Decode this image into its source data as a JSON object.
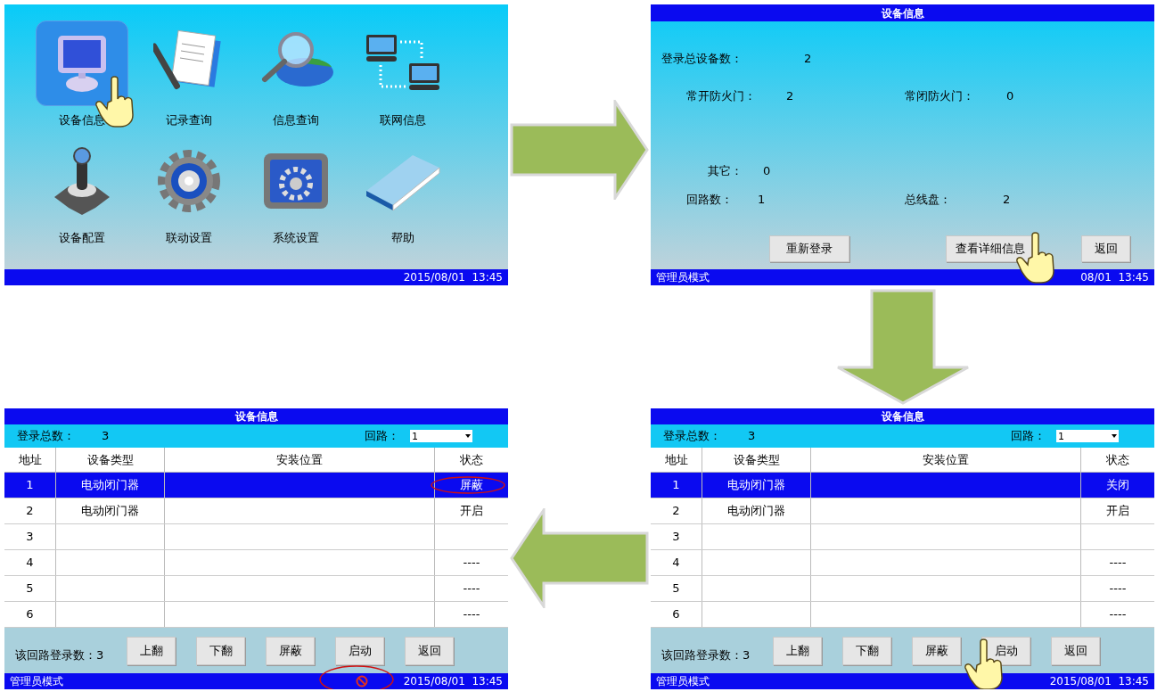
{
  "menu_screen": {
    "menu_items": [
      {
        "label": "设备信息",
        "selected": true
      },
      {
        "label": "记录查询",
        "selected": false
      },
      {
        "label": "信息查询",
        "selected": false
      },
      {
        "label": "联网信息",
        "selected": false
      },
      {
        "label": "设备配置",
        "selected": false
      },
      {
        "label": "联动设置",
        "selected": false
      },
      {
        "label": "系统设置",
        "selected": false
      },
      {
        "label": "帮助",
        "selected": false
      }
    ],
    "status_bar": {
      "datetime": "2015/08/01  13:45"
    }
  },
  "summary_screen": {
    "title": "设备信息",
    "field_rows": [
      [
        {
          "label": "登录总设备数：",
          "value": "2"
        }
      ],
      [
        {
          "label": "常开防火门：",
          "value": "2"
        },
        {
          "label": "常闭防火门：",
          "value": "0"
        }
      ],
      [
        {
          "label": "其它：",
          "value": "0"
        }
      ],
      [
        {
          "label": "回路数：",
          "value": "1"
        },
        {
          "label": "总线盘：",
          "value": "2"
        }
      ]
    ],
    "buttons": [
      "重新登录",
      "查看详细信息",
      "返回"
    ],
    "status_bar": {
      "mode": "管理员模式",
      "datetime": "08/01  13:45"
    }
  },
  "table_screens": [
    {
      "title": "设备信息",
      "total_label": "登录总数：",
      "total_value": "3",
      "loop_label": "回路：",
      "loop_value": "1",
      "columns": [
        "地址",
        "设备类型",
        "安装位置",
        "状态"
      ],
      "rows": [
        {
          "address": "1",
          "type": "电动闭门器",
          "status": "屏蔽",
          "selected": true,
          "circled": true
        },
        {
          "address": "2",
          "type": "电动闭门器",
          "status": "开启",
          "selected": false,
          "circled": false
        },
        {
          "address": "3",
          "selected": false,
          "circled": false
        },
        {
          "address": "4",
          "status": "----",
          "selected": false,
          "circled": false
        },
        {
          "address": "5",
          "status": "----",
          "selected": false,
          "circled": false
        },
        {
          "address": "6",
          "status": "----",
          "selected": false,
          "circled": false
        }
      ],
      "loop_count_label": "该回路登录数：",
      "loop_count_value": "3",
      "buttons": [
        "上翻",
        "下翻",
        "屏蔽",
        "启动",
        "返回"
      ],
      "status_bar": {
        "mode": "管理员模式",
        "datetime": "2015/08/01  13:45",
        "ban_shown": true
      }
    },
    {
      "title": "设备信息",
      "total_label": "登录总数：",
      "total_value": "3",
      "loop_label": "回路：",
      "loop_value": "1",
      "columns": [
        "地址",
        "设备类型",
        "安装位置",
        "状态"
      ],
      "rows": [
        {
          "address": "1",
          "type": "电动闭门器",
          "status": "关闭",
          "selected": true,
          "circled": false
        },
        {
          "address": "2",
          "type": "电动闭门器",
          "status": "开启",
          "selected": false,
          "circled": false
        },
        {
          "address": "3",
          "selected": false,
          "circled": false
        },
        {
          "address": "4",
          "status": "----",
          "selected": false,
          "circled": false
        },
        {
          "address": "5",
          "status": "----",
          "selected": false,
          "circled": false
        },
        {
          "address": "6",
          "status": "----",
          "selected": false,
          "circled": false
        }
      ],
      "loop_count_label": "该回路登录数：",
      "loop_count_value": "3",
      "buttons": [
        "上翻",
        "下翻",
        "屏蔽",
        "启动",
        "返回"
      ],
      "status_bar": {
        "mode": "管理员模式",
        "datetime": "2015/08/01  13:45",
        "ban_shown": false
      }
    }
  ]
}
